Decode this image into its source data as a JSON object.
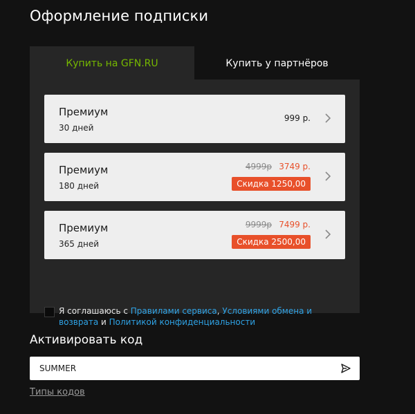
{
  "page_title": "Оформление подписки",
  "tabs": [
    {
      "label": "Купить на GFN.RU",
      "active": true
    },
    {
      "label": "Купить у партнёров",
      "active": false
    }
  ],
  "plans": [
    {
      "name": "Премиум",
      "duration": "30 дней",
      "price": "999 р."
    },
    {
      "name": "Премиум",
      "duration": "180 дней",
      "old_price": "4999р",
      "new_price": "3749 р.",
      "discount": "Скидка 1250,00"
    },
    {
      "name": "Премиум",
      "duration": "365 дней",
      "old_price": "9999р",
      "new_price": "7499 р.",
      "discount": "Скидка 2500,00"
    }
  ],
  "agreement": {
    "prefix": "Я соглашаюсь с ",
    "link_rules": "Правилами сервиса",
    "sep1": ", ",
    "link_exchange": "Условиями обмена и возврата",
    "and": " и ",
    "link_privacy": "Политикой конфиденциальности",
    "checked": false
  },
  "activate": {
    "title": "Активировать код",
    "code_value": "SUMMER",
    "code_types_link": "Типы кодов"
  },
  "colors": {
    "accent_green": "#76b900",
    "discount_orange": "#e8502a",
    "link_blue": "#2fa3e6",
    "background": "#121212",
    "panel": "#262626"
  }
}
